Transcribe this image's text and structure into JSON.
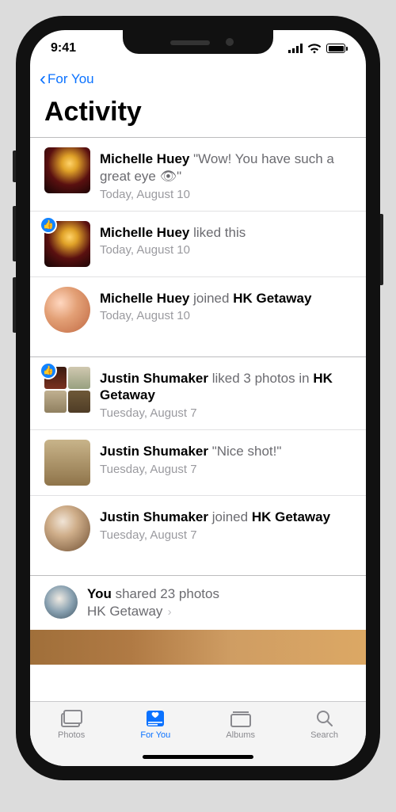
{
  "status": {
    "time": "9:41"
  },
  "nav": {
    "back_label": "For You",
    "title": "Activity"
  },
  "activity": [
    {
      "name": "Michelle Huey",
      "rest": " \"Wow! You have such a great eye 👁\"",
      "date": "Today, August 10"
    },
    {
      "name": "Michelle Huey",
      "rest": " liked this",
      "date": "Today, August 10"
    },
    {
      "name": "Michelle Huey",
      "verb": " joined ",
      "target": "HK Getaway",
      "date": "Today, August 10"
    },
    {
      "name": "Justin Shumaker",
      "verb": " liked 3 photos in ",
      "target": "HK Getaway",
      "date": "Tuesday, August 7"
    },
    {
      "name": "Justin Shumaker",
      "rest": " \"Nice shot!\"",
      "date": "Tuesday, August 7"
    },
    {
      "name": "Justin Shumaker",
      "verb": " joined ",
      "target": "HK Getaway",
      "date": "Tuesday, August 7"
    },
    {
      "name": "You",
      "rest": " shared 23 photos",
      "subtitle": "HK Getaway"
    }
  ],
  "tabs": {
    "photos": "Photos",
    "for_you": "For You",
    "albums": "Albums",
    "search": "Search"
  }
}
